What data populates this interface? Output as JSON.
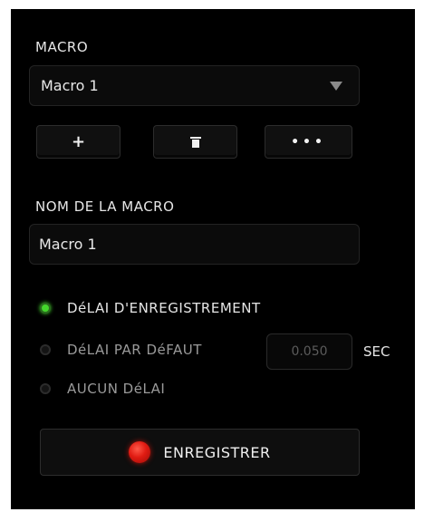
{
  "macro_section": {
    "title": "MACRO",
    "selected_macro": "Macro 1",
    "add_label": "+",
    "more_label": "•••"
  },
  "name_section": {
    "title": "NOM DE LA MACRO",
    "name_value": "Macro 1"
  },
  "delay_options": [
    {
      "label": "DéLAI D'ENREGISTREMENT",
      "selected": true
    },
    {
      "label": "DéLAI PAR DéFAUT",
      "selected": false
    },
    {
      "label": "AUCUN DéLAI",
      "selected": false
    }
  ],
  "default_delay": {
    "value": "0.050",
    "unit": "SEC"
  },
  "record_button": {
    "label": "ENREGISTRER"
  },
  "colors": {
    "accent_green": "#44d62c",
    "record_red": "#e01b12",
    "panel_background": "#000000"
  }
}
